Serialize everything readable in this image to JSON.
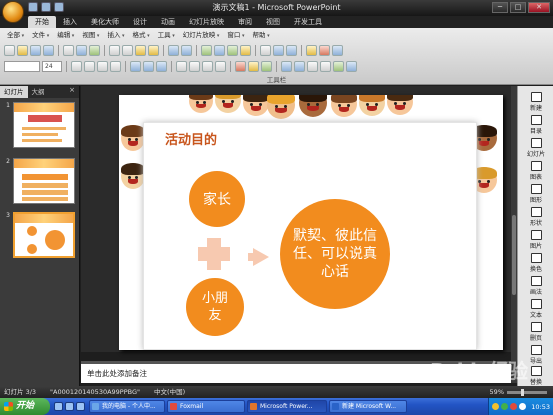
{
  "window": {
    "title": "演示文稿1 - Microsoft PowerPoint",
    "controls": [
      "─",
      "□",
      "✕"
    ]
  },
  "ribbon_tabs": [
    "开始",
    "插入",
    "美化大师",
    "设计",
    "动画",
    "幻灯片放映",
    "审阅",
    "视图",
    "开发工具"
  ],
  "menu_bar": [
    "全部",
    "文件",
    "编辑",
    "视图",
    "插入",
    "格式",
    "工具",
    "幻灯片放映",
    "窗口",
    "帮助"
  ],
  "font_size": "24",
  "ribbon_group_label": "工具栏",
  "left_panel": {
    "tabs": [
      "幻灯片",
      "大纲"
    ],
    "close": "×",
    "slides": [
      {
        "number": "1",
        "thumb_title": "活动目的"
      },
      {
        "number": "2"
      },
      {
        "number": "3"
      }
    ]
  },
  "slide": {
    "title": "活动目的",
    "parent_label": "家长",
    "child_label": "小朋友",
    "result_label": "默契、彼此信任、可以说真心话"
  },
  "notes_placeholder": "单击此处添加备注",
  "right_panel": {
    "items": [
      "新建",
      "目录",
      "幻灯片",
      "图表",
      "图形",
      "形状",
      "图片",
      "换色",
      "画法",
      "文本",
      "删页",
      "导出",
      "替换"
    ]
  },
  "status_bar": {
    "slide_position": "幻灯片 3/3",
    "theme": "\"A000120140530A99PPBG\"",
    "language": "中文(中国)",
    "zoom": "59%"
  },
  "taskbar": {
    "start": "开始",
    "tasks": [
      {
        "label": "我的电脑 - 个人中...",
        "icon_color": "#6aa6e8"
      },
      {
        "label": "Foxmail",
        "icon_color": "#e24a3b"
      },
      {
        "label": "Microsoft Power...",
        "icon_color": "#e2752a"
      },
      {
        "label": "新建 Microsoft W...",
        "icon_color": "#2a63c8"
      }
    ],
    "clock": "10:53"
  },
  "watermark": "Baidu经验",
  "colors": {
    "accent_orange": "#f28c1e",
    "light_peach": "#f7c9b0",
    "title_color": "#c8551c"
  }
}
